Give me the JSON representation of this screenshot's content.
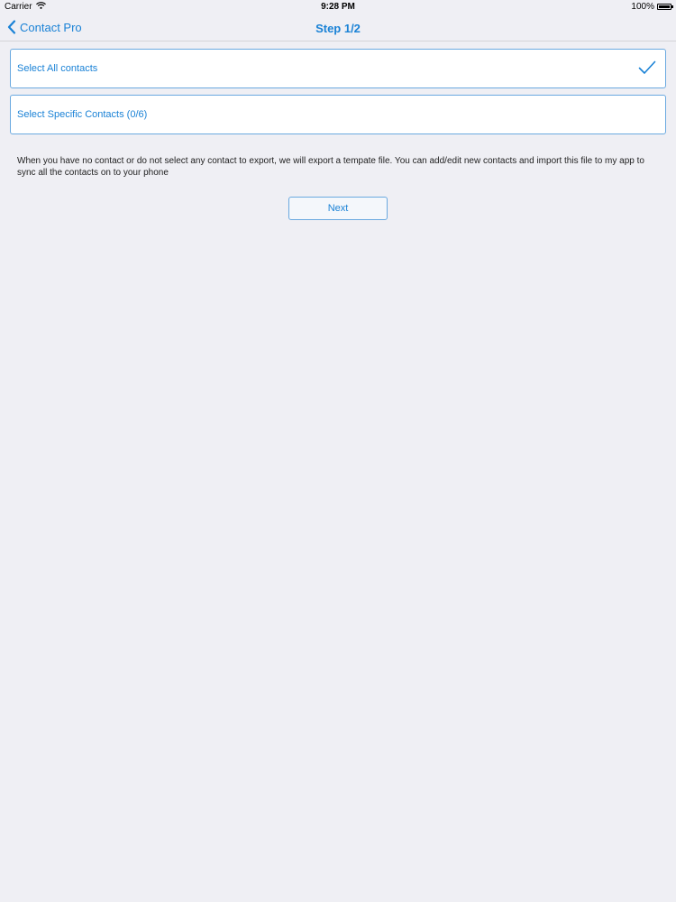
{
  "status_bar": {
    "carrier": "Carrier",
    "wifi_icon": "wifi-icon",
    "time": "9:28 PM",
    "battery_percent": "100%",
    "battery_icon": "battery-icon"
  },
  "nav": {
    "back_label": "Contact Pro",
    "back_icon": "chevron-left-icon",
    "title": "Step 1/2"
  },
  "options": {
    "select_all_label": "Select All contacts",
    "select_all_checked": true,
    "check_icon": "checkmark-icon",
    "select_specific_label": "Select Specific Contacts (0/6)"
  },
  "info_text": "When you have no contact or do not select any contact to export, we will  export a tempate file. You can add/edit new contacts and import this file to my app to sync all the contacts on to your phone",
  "next_label": "Next",
  "colors": {
    "accent": "#1a82d6",
    "border": "#6aa9e0",
    "background": "#efeff4"
  }
}
